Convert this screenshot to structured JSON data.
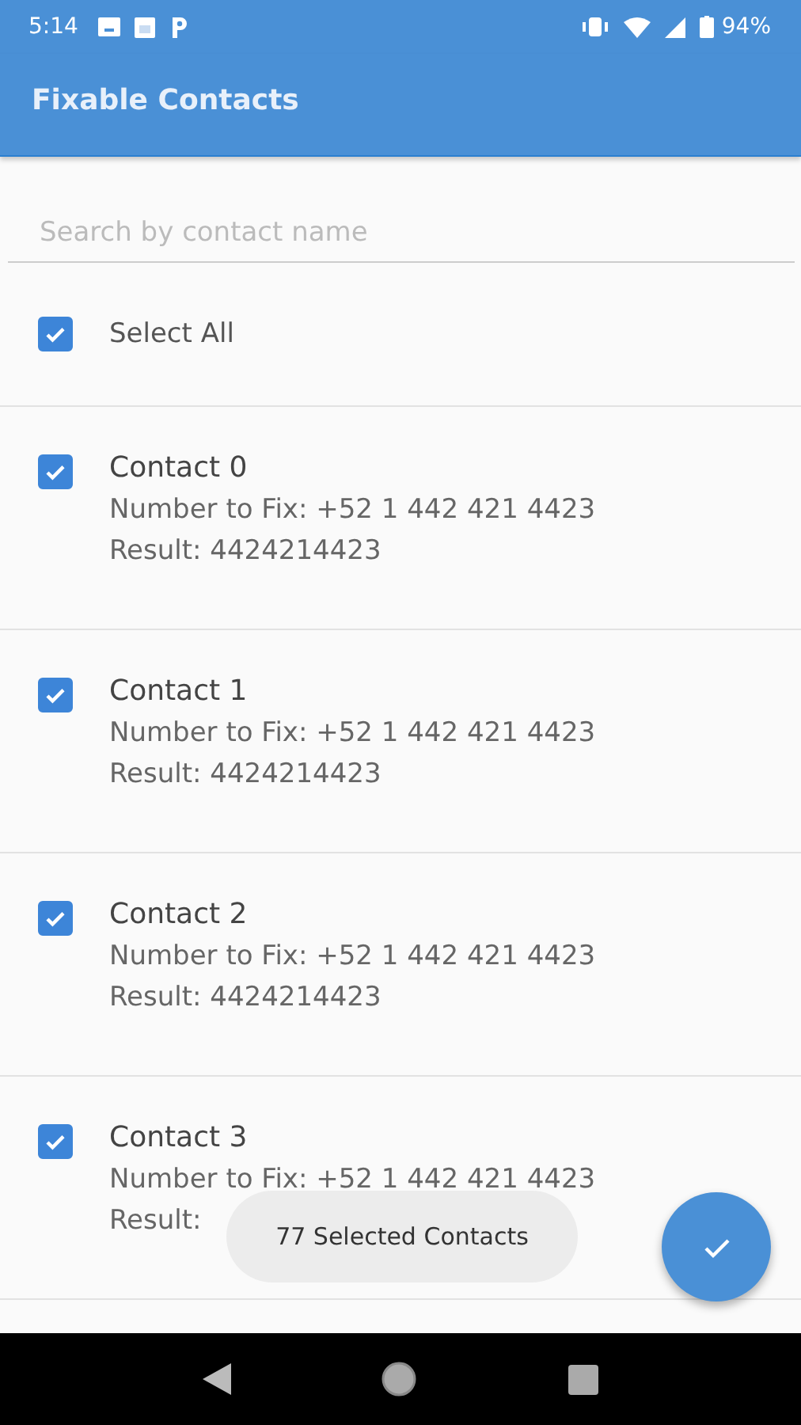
{
  "status_bar": {
    "time": "5:14",
    "battery": "94%"
  },
  "app_bar": {
    "title": "Fixable Contacts"
  },
  "search": {
    "placeholder": "Search by contact name"
  },
  "select_all": {
    "label": "Select All",
    "checked": true
  },
  "contacts": [
    {
      "name": "Contact 0",
      "number": "Number to Fix: +52 1 442 421 4423",
      "result": "Result: 4424214423",
      "checked": true
    },
    {
      "name": "Contact 1",
      "number": "Number to Fix: +52 1 442 421 4423",
      "result": "Result: 4424214423",
      "checked": true
    },
    {
      "name": "Contact 2",
      "number": "Number to Fix: +52 1 442 421 4423",
      "result": "Result: 4424214423",
      "checked": true
    },
    {
      "name": "Contact 3",
      "number": "Number to Fix: +52 1 442 421 4423",
      "result": "Result:",
      "checked": true
    }
  ],
  "toast": {
    "text": "77 Selected Contacts"
  }
}
